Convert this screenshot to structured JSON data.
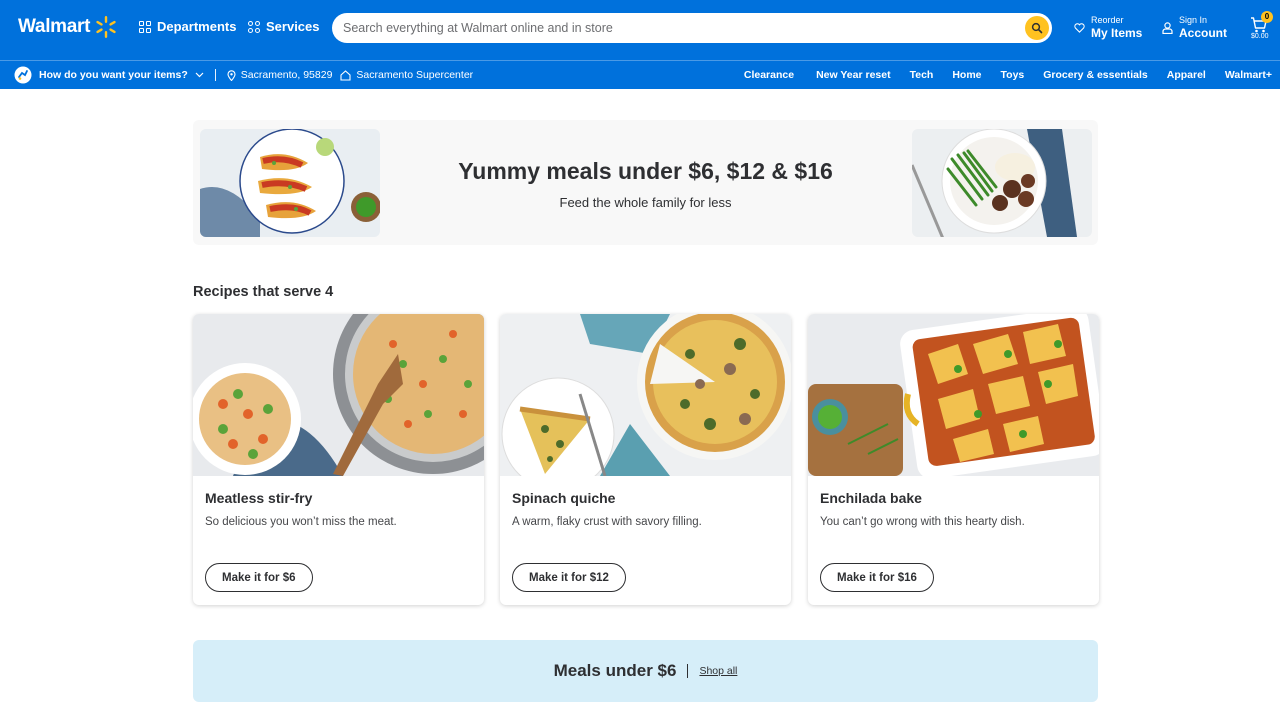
{
  "header": {
    "logo_text": "Walmart",
    "departments_label": "Departments",
    "services_label": "Services",
    "search_placeholder": "Search everything at Walmart online and in store",
    "reorder_small": "Reorder",
    "reorder_big": "My Items",
    "signin_small": "Sign In",
    "signin_big": "Account",
    "cart_count": "0",
    "cart_total": "$0.00",
    "brand_color": "#0071dc",
    "accent_color": "#ffc220"
  },
  "subbar": {
    "delivery_question": "How do you want your items?",
    "location": "Sacramento, 95829",
    "store": "Sacramento Supercenter",
    "links": [
      "Clearance",
      "New Year reset",
      "Tech",
      "Home",
      "Toys",
      "Grocery & essentials",
      "Apparel",
      "Walmart+"
    ]
  },
  "hero": {
    "title": "Yummy meals under $6, $12 & $16",
    "subtitle": "Feed the whole family for less"
  },
  "recipes": {
    "section_title": "Recipes that serve 4",
    "cards": [
      {
        "title": "Meatless stir-fry",
        "desc": "So delicious you won’t miss the meat.",
        "button": "Make it for $6"
      },
      {
        "title": "Spinach quiche",
        "desc": "A warm, flaky crust with savory filling.",
        "button": "Make it for $12"
      },
      {
        "title": "Enchilada bake",
        "desc": "You can’t go wrong with this hearty dish.",
        "button": "Make it for $16"
      }
    ]
  },
  "bottom_banner": {
    "title": "Meals under $6",
    "link": "Shop all",
    "bg_color": "#d6eef9"
  }
}
